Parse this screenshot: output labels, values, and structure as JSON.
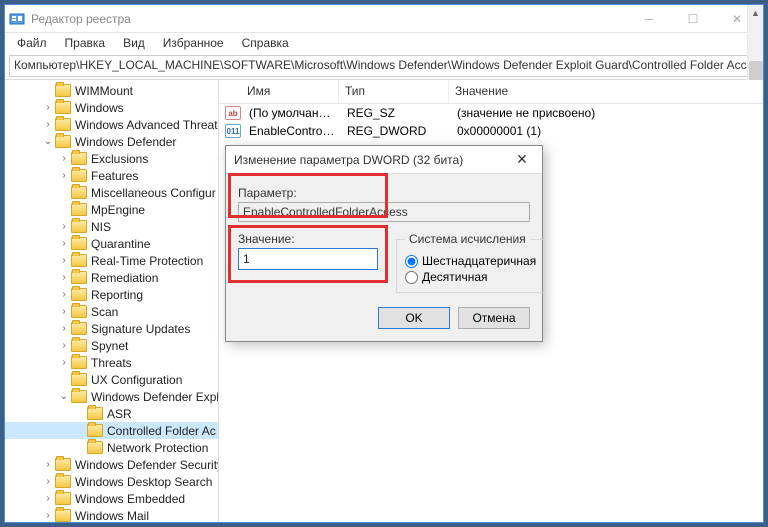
{
  "titlebar": {
    "title": "Редактор реестра"
  },
  "menu": [
    "Файл",
    "Правка",
    "Вид",
    "Избранное",
    "Справка"
  ],
  "address": "Компьютер\\HKEY_LOCAL_MACHINE\\SOFTWARE\\Microsoft\\Windows Defender\\Windows Defender Exploit Guard\\Controlled Folder Access",
  "tree": [
    {
      "label": "WIMMount",
      "depth": 2,
      "expander": ""
    },
    {
      "label": "Windows",
      "depth": 2,
      "expander": "›"
    },
    {
      "label": "Windows Advanced Threat",
      "depth": 2,
      "expander": "›"
    },
    {
      "label": "Windows Defender",
      "depth": 2,
      "expander": "⌄",
      "open": true
    },
    {
      "label": "Exclusions",
      "depth": 3,
      "expander": "›"
    },
    {
      "label": "Features",
      "depth": 3,
      "expander": "›"
    },
    {
      "label": "Miscellaneous Configur",
      "depth": 3,
      "expander": ""
    },
    {
      "label": "MpEngine",
      "depth": 3,
      "expander": ""
    },
    {
      "label": "NIS",
      "depth": 3,
      "expander": "›"
    },
    {
      "label": "Quarantine",
      "depth": 3,
      "expander": "›"
    },
    {
      "label": "Real-Time Protection",
      "depth": 3,
      "expander": "›"
    },
    {
      "label": "Remediation",
      "depth": 3,
      "expander": "›"
    },
    {
      "label": "Reporting",
      "depth": 3,
      "expander": "›"
    },
    {
      "label": "Scan",
      "depth": 3,
      "expander": "›"
    },
    {
      "label": "Signature Updates",
      "depth": 3,
      "expander": "›"
    },
    {
      "label": "Spynet",
      "depth": 3,
      "expander": "›"
    },
    {
      "label": "Threats",
      "depth": 3,
      "expander": "›"
    },
    {
      "label": "UX Configuration",
      "depth": 3,
      "expander": ""
    },
    {
      "label": "Windows Defender Expl",
      "depth": 3,
      "expander": "⌄",
      "open": true
    },
    {
      "label": "ASR",
      "depth": 4,
      "expander": ""
    },
    {
      "label": "Controlled Folder Ac",
      "depth": 4,
      "expander": "",
      "selected": true
    },
    {
      "label": "Network Protection",
      "depth": 4,
      "expander": ""
    },
    {
      "label": "Windows Defender Security",
      "depth": 2,
      "expander": "›"
    },
    {
      "label": "Windows Desktop Search",
      "depth": 2,
      "expander": "›"
    },
    {
      "label": "Windows Embedded",
      "depth": 2,
      "expander": "›"
    },
    {
      "label": "Windows Mail",
      "depth": 2,
      "expander": "›"
    }
  ],
  "list": {
    "columns": {
      "name": "Имя",
      "type": "Тип",
      "value": "Значение"
    },
    "rows": [
      {
        "icon": "ab",
        "name": "(По умолчанию)",
        "type": "REG_SZ",
        "value": "(значение не присвоено)"
      },
      {
        "icon": "01",
        "name": "EnableControlle...",
        "type": "REG_DWORD",
        "value": "0x00000001 (1)"
      }
    ]
  },
  "dialog": {
    "title": "Изменение параметра DWORD (32 бита)",
    "param_label": "Параметр:",
    "param_value": "EnableControlledFolderAccess",
    "value_label": "Значение:",
    "value": "1",
    "base_legend": "Система исчисления",
    "base_hex": "Шестнадцатеричная",
    "base_dec": "Десятичная",
    "ok": "OK",
    "cancel": "Отмена"
  }
}
